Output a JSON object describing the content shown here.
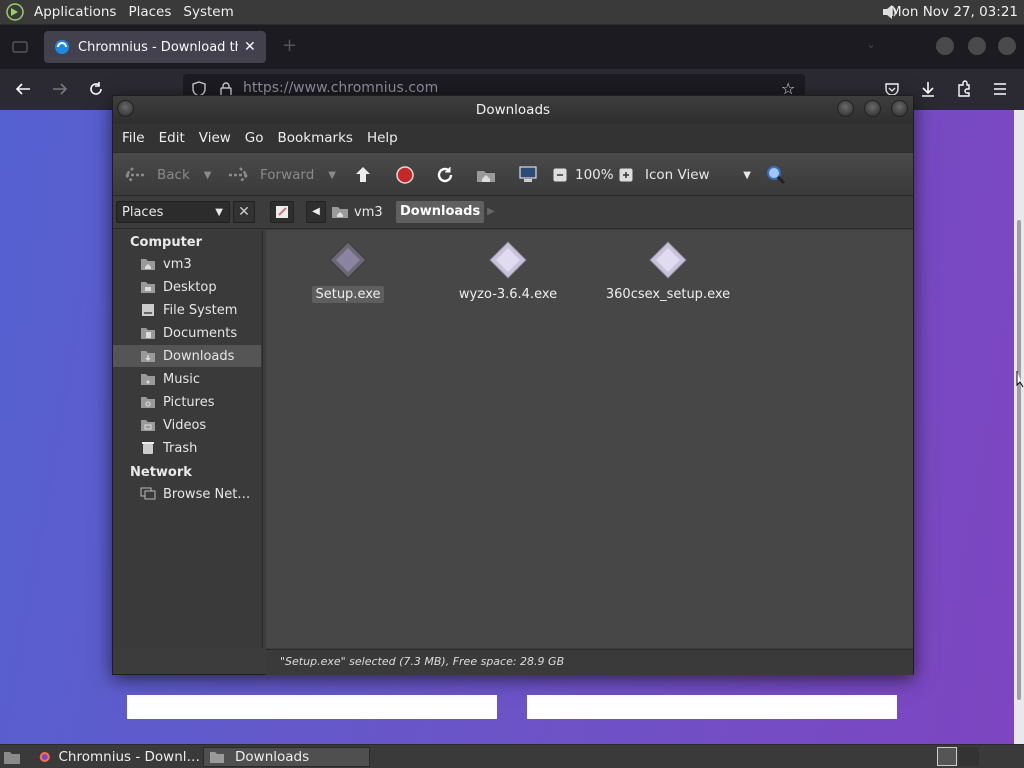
{
  "top_panel": {
    "menus": [
      "Applications",
      "Places",
      "System"
    ],
    "clock": "Mon Nov 27, 03:21"
  },
  "browser": {
    "tab_title": "Chromnius - Download the",
    "url": "https://www.chromnius.com"
  },
  "file_manager": {
    "window_title": "Downloads",
    "menu": [
      "File",
      "Edit",
      "View",
      "Go",
      "Bookmarks",
      "Help"
    ],
    "toolbar": {
      "back": "Back",
      "forward": "Forward",
      "zoom": "100%",
      "view_mode": "Icon View"
    },
    "location": {
      "side_pane": "Places",
      "crumbs": [
        "vm3",
        "Downloads"
      ]
    },
    "sidebar": {
      "computer_heading": "Computer",
      "computer_items": [
        "vm3",
        "Desktop",
        "File System",
        "Documents",
        "Downloads",
        "Music",
        "Pictures",
        "Videos",
        "Trash"
      ],
      "selected": "Downloads",
      "network_heading": "Network",
      "network_items": [
        "Browse Net…"
      ]
    },
    "files": [
      {
        "name": "Setup.exe",
        "selected": true
      },
      {
        "name": "wyzo-3.6.4.exe",
        "selected": false
      },
      {
        "name": "360csex_setup.exe",
        "selected": false
      }
    ],
    "status": "\"Setup.exe\" selected (7.3 MB), Free space: 28.9 GB"
  },
  "taskbar": {
    "tasks": [
      "Chromnius - Downl…",
      "Downloads"
    ]
  },
  "colors": {
    "page_gradient_start": "#5561d0",
    "page_gradient_end": "#7d45c0",
    "selection": "#555555"
  }
}
